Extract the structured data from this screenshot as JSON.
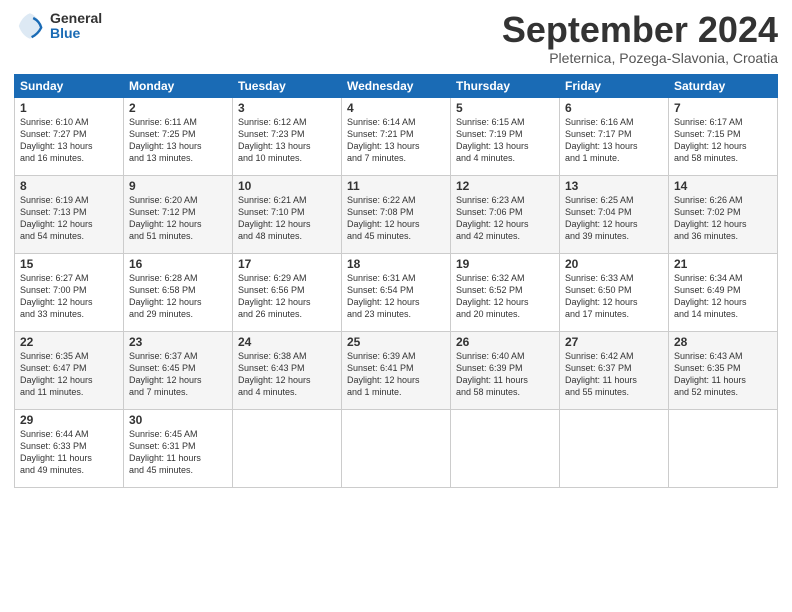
{
  "header": {
    "logo_general": "General",
    "logo_blue": "Blue",
    "month_title": "September 2024",
    "location": "Pleternica, Pozega-Slavonia, Croatia"
  },
  "days_of_week": [
    "Sunday",
    "Monday",
    "Tuesday",
    "Wednesday",
    "Thursday",
    "Friday",
    "Saturday"
  ],
  "weeks": [
    [
      {
        "day": 1,
        "sunrise": "6:10 AM",
        "sunset": "7:27 PM",
        "daylight": "13 hours and 16 minutes."
      },
      {
        "day": 2,
        "sunrise": "6:11 AM",
        "sunset": "7:25 PM",
        "daylight": "13 hours and 13 minutes."
      },
      {
        "day": 3,
        "sunrise": "6:12 AM",
        "sunset": "7:23 PM",
        "daylight": "13 hours and 10 minutes."
      },
      {
        "day": 4,
        "sunrise": "6:14 AM",
        "sunset": "7:21 PM",
        "daylight": "13 hours and 7 minutes."
      },
      {
        "day": 5,
        "sunrise": "6:15 AM",
        "sunset": "7:19 PM",
        "daylight": "13 hours and 4 minutes."
      },
      {
        "day": 6,
        "sunrise": "6:16 AM",
        "sunset": "7:17 PM",
        "daylight": "13 hours and 1 minute."
      },
      {
        "day": 7,
        "sunrise": "6:17 AM",
        "sunset": "7:15 PM",
        "daylight": "12 hours and 58 minutes."
      }
    ],
    [
      {
        "day": 8,
        "sunrise": "6:19 AM",
        "sunset": "7:13 PM",
        "daylight": "12 hours and 54 minutes."
      },
      {
        "day": 9,
        "sunrise": "6:20 AM",
        "sunset": "7:12 PM",
        "daylight": "12 hours and 51 minutes."
      },
      {
        "day": 10,
        "sunrise": "6:21 AM",
        "sunset": "7:10 PM",
        "daylight": "12 hours and 48 minutes."
      },
      {
        "day": 11,
        "sunrise": "6:22 AM",
        "sunset": "7:08 PM",
        "daylight": "12 hours and 45 minutes."
      },
      {
        "day": 12,
        "sunrise": "6:23 AM",
        "sunset": "7:06 PM",
        "daylight": "12 hours and 42 minutes."
      },
      {
        "day": 13,
        "sunrise": "6:25 AM",
        "sunset": "7:04 PM",
        "daylight": "12 hours and 39 minutes."
      },
      {
        "day": 14,
        "sunrise": "6:26 AM",
        "sunset": "7:02 PM",
        "daylight": "12 hours and 36 minutes."
      }
    ],
    [
      {
        "day": 15,
        "sunrise": "6:27 AM",
        "sunset": "7:00 PM",
        "daylight": "12 hours and 33 minutes."
      },
      {
        "day": 16,
        "sunrise": "6:28 AM",
        "sunset": "6:58 PM",
        "daylight": "12 hours and 29 minutes."
      },
      {
        "day": 17,
        "sunrise": "6:29 AM",
        "sunset": "6:56 PM",
        "daylight": "12 hours and 26 minutes."
      },
      {
        "day": 18,
        "sunrise": "6:31 AM",
        "sunset": "6:54 PM",
        "daylight": "12 hours and 23 minutes."
      },
      {
        "day": 19,
        "sunrise": "6:32 AM",
        "sunset": "6:52 PM",
        "daylight": "12 hours and 20 minutes."
      },
      {
        "day": 20,
        "sunrise": "6:33 AM",
        "sunset": "6:50 PM",
        "daylight": "12 hours and 17 minutes."
      },
      {
        "day": 21,
        "sunrise": "6:34 AM",
        "sunset": "6:49 PM",
        "daylight": "12 hours and 14 minutes."
      }
    ],
    [
      {
        "day": 22,
        "sunrise": "6:35 AM",
        "sunset": "6:47 PM",
        "daylight": "12 hours and 11 minutes."
      },
      {
        "day": 23,
        "sunrise": "6:37 AM",
        "sunset": "6:45 PM",
        "daylight": "12 hours and 7 minutes."
      },
      {
        "day": 24,
        "sunrise": "6:38 AM",
        "sunset": "6:43 PM",
        "daylight": "12 hours and 4 minutes."
      },
      {
        "day": 25,
        "sunrise": "6:39 AM",
        "sunset": "6:41 PM",
        "daylight": "12 hours and 1 minute."
      },
      {
        "day": 26,
        "sunrise": "6:40 AM",
        "sunset": "6:39 PM",
        "daylight": "11 hours and 58 minutes."
      },
      {
        "day": 27,
        "sunrise": "6:42 AM",
        "sunset": "6:37 PM",
        "daylight": "11 hours and 55 minutes."
      },
      {
        "day": 28,
        "sunrise": "6:43 AM",
        "sunset": "6:35 PM",
        "daylight": "11 hours and 52 minutes."
      }
    ],
    [
      {
        "day": 29,
        "sunrise": "6:44 AM",
        "sunset": "6:33 PM",
        "daylight": "11 hours and 49 minutes."
      },
      {
        "day": 30,
        "sunrise": "6:45 AM",
        "sunset": "6:31 PM",
        "daylight": "11 hours and 45 minutes."
      },
      null,
      null,
      null,
      null,
      null
    ]
  ]
}
